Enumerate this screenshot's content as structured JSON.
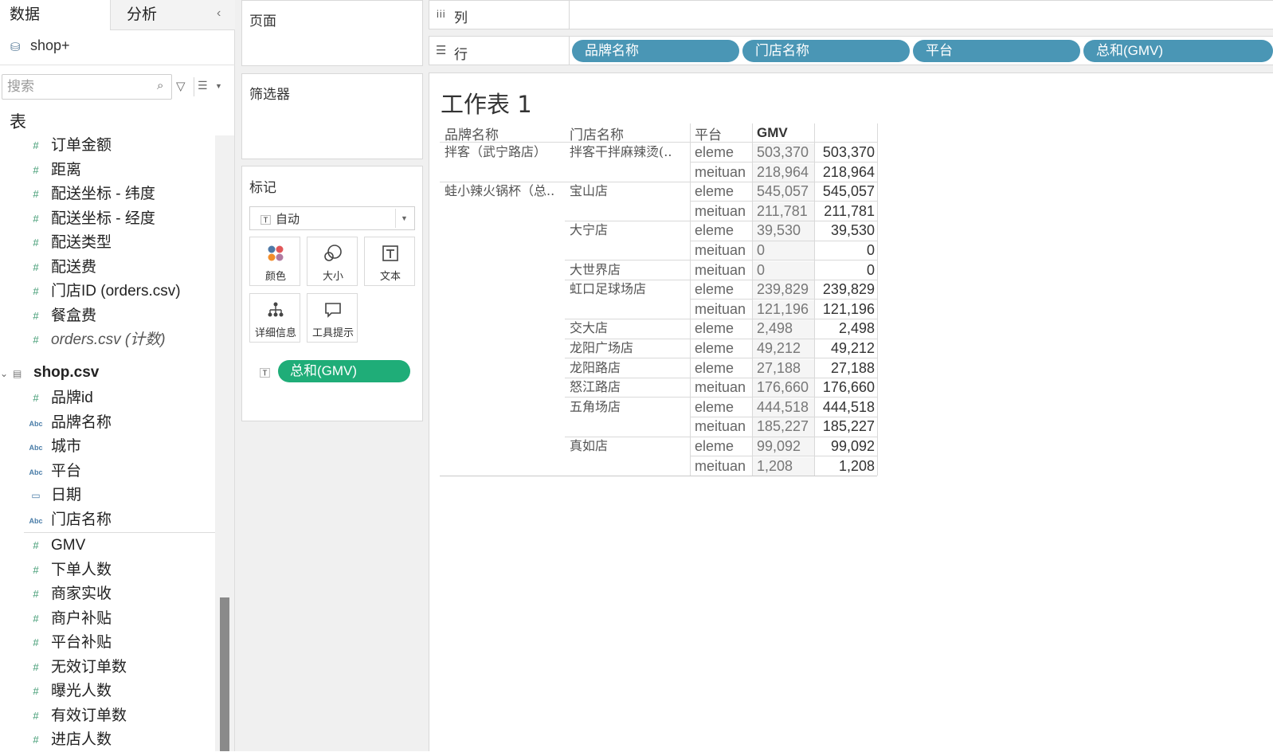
{
  "left_pane": {
    "tab_data": "数据",
    "tab_analysis": "分析",
    "datasource": "shop+",
    "search_placeholder": "搜索",
    "tables_header": "表",
    "orders_fields": [
      {
        "icon": "measure",
        "label": "订单金额"
      },
      {
        "icon": "measure",
        "label": "距离"
      },
      {
        "icon": "measure",
        "label": "配送坐标 - 纬度"
      },
      {
        "icon": "measure",
        "label": "配送坐标 - 经度"
      },
      {
        "icon": "measure",
        "label": "配送类型"
      },
      {
        "icon": "measure",
        "label": "配送费"
      },
      {
        "icon": "measure",
        "label": "门店ID (orders.csv)"
      },
      {
        "icon": "measure",
        "label": "餐盒费"
      },
      {
        "icon": "measure",
        "label": "orders.csv (计数)"
      }
    ],
    "shop_group": "shop.csv",
    "shop_dimensions": [
      {
        "icon": "measure",
        "label": "品牌id"
      },
      {
        "icon": "string",
        "label": "品牌名称"
      },
      {
        "icon": "string",
        "label": "城市"
      },
      {
        "icon": "string",
        "label": "平台"
      },
      {
        "icon": "date",
        "label": "日期"
      },
      {
        "icon": "string",
        "label": "门店名称"
      }
    ],
    "shop_measures": [
      {
        "icon": "measure",
        "label": "GMV"
      },
      {
        "icon": "measure",
        "label": "下单人数"
      },
      {
        "icon": "measure",
        "label": "商家实收"
      },
      {
        "icon": "measure",
        "label": "商户补贴"
      },
      {
        "icon": "measure",
        "label": "平台补贴"
      },
      {
        "icon": "measure",
        "label": "无效订单数"
      },
      {
        "icon": "measure",
        "label": "曝光人数"
      },
      {
        "icon": "measure",
        "label": "有效订单数"
      },
      {
        "icon": "measure",
        "label": "进店人数"
      }
    ]
  },
  "cards": {
    "pages": "页面",
    "filters": "筛选器",
    "marks": "标记",
    "mark_type": "自动",
    "buttons": {
      "color": "颜色",
      "size": "大小",
      "text": "文本",
      "detail": "详细信息",
      "tooltip": "工具提示"
    },
    "mark_pill": "总和(GMV)"
  },
  "shelves": {
    "columns_label": "列",
    "rows_label": "行",
    "row_pills": [
      "品牌名称",
      "门店名称",
      "平台",
      "总和(GMV)"
    ]
  },
  "view": {
    "title": "工作表 1",
    "headers": {
      "brand": "品牌名称",
      "store": "门店名称",
      "platform": "平台",
      "gmv": "GMV"
    },
    "brands": [
      {
        "name": "拌客（武宁路店）",
        "row": 0
      },
      {
        "name": "蛙小辣火锅杯（总..",
        "row": 2
      }
    ],
    "stores": [
      {
        "name": "拌客干拌麻辣烫(..",
        "row": 0
      },
      {
        "name": "宝山店",
        "row": 2
      },
      {
        "name": "大宁店",
        "row": 4
      },
      {
        "name": "大世界店",
        "row": 6
      },
      {
        "name": "虹口足球场店",
        "row": 7
      },
      {
        "name": "交大店",
        "row": 9
      },
      {
        "name": "龙阳广场店",
        "row": 10
      },
      {
        "name": "龙阳路店",
        "row": 11
      },
      {
        "name": "怒江路店",
        "row": 12
      },
      {
        "name": "五角场店",
        "row": 13
      },
      {
        "name": "真如店",
        "row": 15
      }
    ],
    "rows": [
      {
        "platform": "eleme",
        "gmv": "503,370",
        "total": "503,370"
      },
      {
        "platform": "meituan",
        "gmv": "218,964",
        "total": "218,964"
      },
      {
        "platform": "eleme",
        "gmv": "545,057",
        "total": "545,057"
      },
      {
        "platform": "meituan",
        "gmv": "211,781",
        "total": "211,781"
      },
      {
        "platform": "eleme",
        "gmv": "39,530",
        "total": "39,530"
      },
      {
        "platform": "meituan",
        "gmv": "0",
        "total": "0"
      },
      {
        "platform": "meituan",
        "gmv": "0",
        "total": "0"
      },
      {
        "platform": "eleme",
        "gmv": "239,829",
        "total": "239,829"
      },
      {
        "platform": "meituan",
        "gmv": "121,196",
        "total": "121,196"
      },
      {
        "platform": "eleme",
        "gmv": "2,498",
        "total": "2,498"
      },
      {
        "platform": "eleme",
        "gmv": "49,212",
        "total": "49,212"
      },
      {
        "platform": "eleme",
        "gmv": "27,188",
        "total": "27,188"
      },
      {
        "platform": "meituan",
        "gmv": "176,660",
        "total": "176,660"
      },
      {
        "platform": "eleme",
        "gmv": "444,518",
        "total": "444,518"
      },
      {
        "platform": "meituan",
        "gmv": "185,227",
        "total": "185,227"
      },
      {
        "platform": "eleme",
        "gmv": "99,092",
        "total": "99,092"
      },
      {
        "platform": "meituan",
        "gmv": "1,208",
        "total": "1,208"
      }
    ]
  }
}
